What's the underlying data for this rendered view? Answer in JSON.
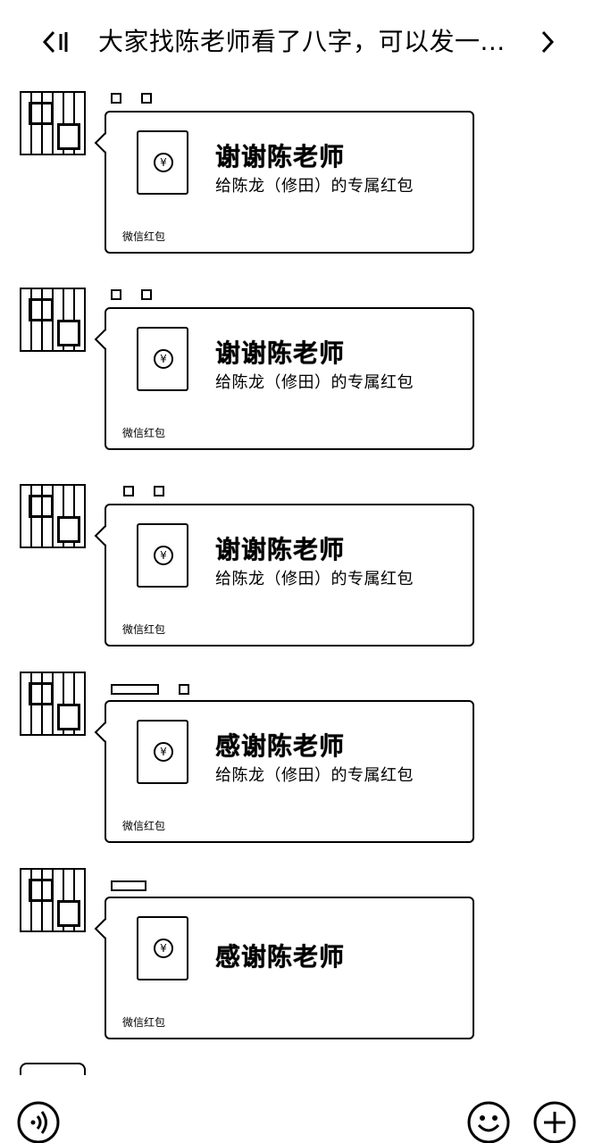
{
  "header": {
    "title": "大家找陈老师看了八字，可以发一..."
  },
  "messages": [
    {
      "title": "谢谢陈老师",
      "subtitle": "给陈龙（修田）的专属红包",
      "brand": "微信红包"
    },
    {
      "title": "谢谢陈老师",
      "subtitle": "给陈龙（修田）的专属红包",
      "brand": "微信红包"
    },
    {
      "title": "谢谢陈老师",
      "subtitle": "给陈龙（修田）的专属红包",
      "brand": "微信红包"
    },
    {
      "title": "感谢陈老师",
      "subtitle": "给陈龙（修田）的专属红包",
      "brand": "微信红包"
    },
    {
      "title": "感谢陈老师",
      "subtitle": "",
      "brand": "微信红包"
    }
  ],
  "coin_symbol": "¥"
}
